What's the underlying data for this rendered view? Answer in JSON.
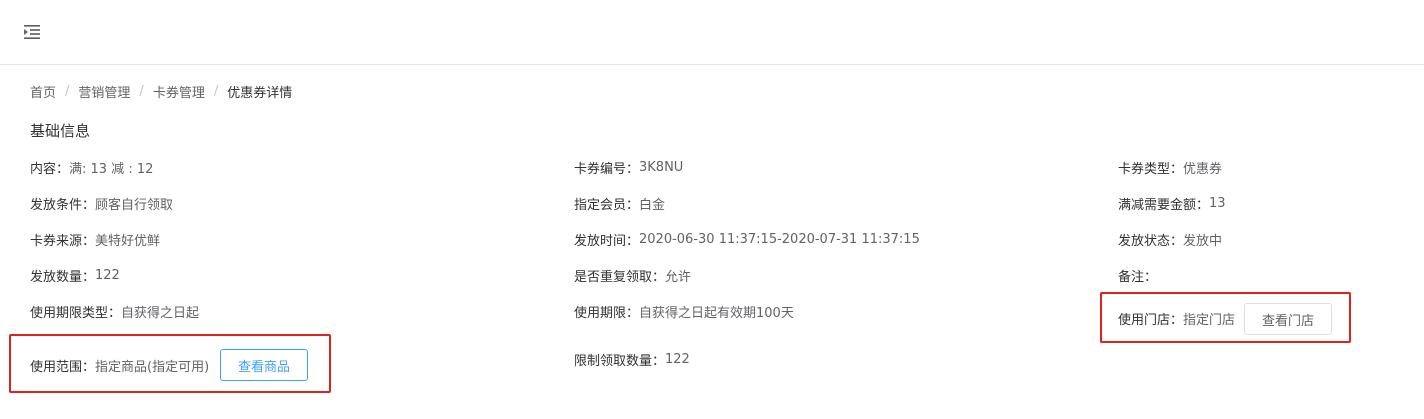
{
  "header": {
    "menu_icon": "menu-fold-icon"
  },
  "breadcrumb": {
    "items": [
      "首页",
      "营销管理",
      "卡券管理",
      "优惠券详情"
    ],
    "separator": "/"
  },
  "section": {
    "title": "基础信息"
  },
  "fields": {
    "content": {
      "label": "内容：",
      "value": "满: 13 减 : 12"
    },
    "coupon_no": {
      "label": "卡券编号：",
      "value": "3K8NU"
    },
    "coupon_type": {
      "label": "卡券类型：",
      "value": "优惠券"
    },
    "issue_condition": {
      "label": "发放条件：",
      "value": "顾客自行领取"
    },
    "member": {
      "label": "指定会员：",
      "value": "白金"
    },
    "threshold": {
      "label": "满减需要金额：",
      "value": "13"
    },
    "source": {
      "label": "卡券来源：",
      "value": "美特好优鲜"
    },
    "issue_time": {
      "label": "发放时间：",
      "value": "2020-06-30 11:37:15-2020-07-31 11:37:15"
    },
    "issue_status": {
      "label": "发放状态：",
      "value": "发放中"
    },
    "quantity": {
      "label": "发放数量：",
      "value": "122"
    },
    "repeat_claim": {
      "label": "是否重复领取：",
      "value": "允许"
    },
    "remark": {
      "label": "备注：",
      "value": ""
    },
    "period_type": {
      "label": "使用期限类型：",
      "value": "自获得之日起"
    },
    "period": {
      "label": "使用期限：",
      "value": "自获得之日起有效期100天"
    },
    "stores": {
      "label": "使用门店：",
      "value": "指定门店",
      "button": "查看门店"
    },
    "scope": {
      "label": "使用范围：",
      "value": "指定商品(指定可用)",
      "button": "查看商品"
    },
    "claim_limit": {
      "label": "限制领取数量：",
      "value": "122"
    }
  },
  "colors": {
    "primary": "#409eff",
    "highlight": "#e0201d",
    "label": "#303133",
    "value": "#606266"
  }
}
